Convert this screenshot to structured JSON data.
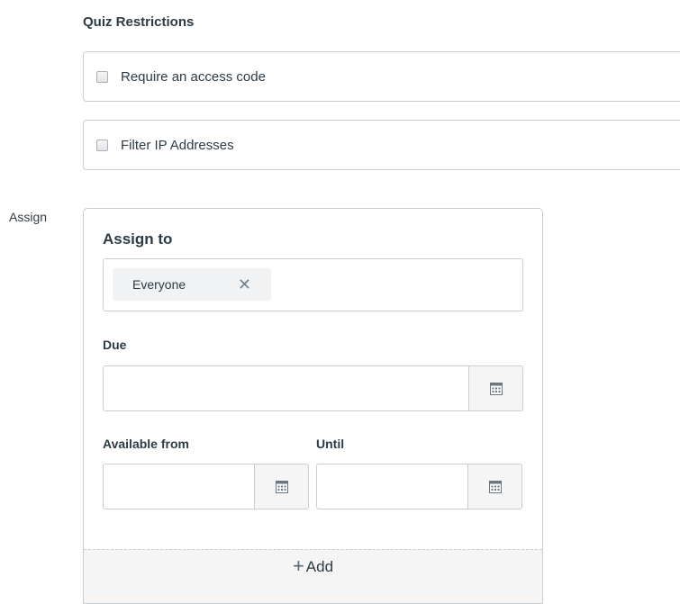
{
  "quiz_restrictions": {
    "title": "Quiz Restrictions",
    "options": [
      {
        "label": "Require an access code",
        "checked": false
      },
      {
        "label": "Filter IP Addresses",
        "checked": false
      }
    ]
  },
  "assign": {
    "section_label": "Assign",
    "card": {
      "assign_to_label": "Assign to",
      "assignees": [
        {
          "label": "Everyone",
          "remove_icon": "close-icon"
        }
      ],
      "due": {
        "label": "Due",
        "value": "",
        "icon": "calendar-icon"
      },
      "available_from": {
        "label": "Available from",
        "value": "",
        "icon": "calendar-icon"
      },
      "until": {
        "label": "Until",
        "value": "",
        "icon": "calendar-icon"
      },
      "add_button": {
        "icon": "plus-icon",
        "label": "Add"
      }
    }
  }
}
